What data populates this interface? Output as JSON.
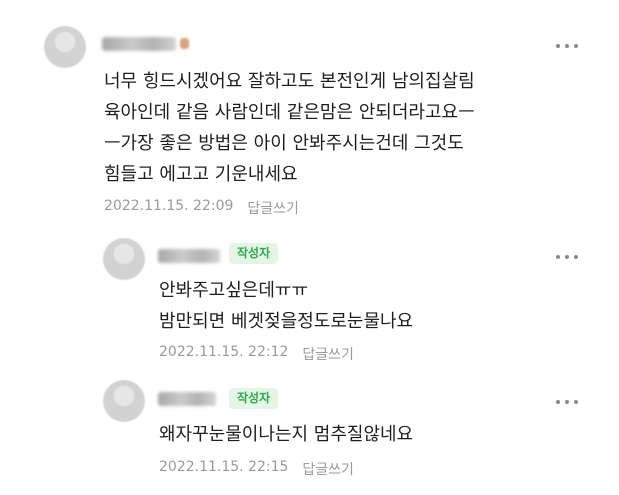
{
  "comments": [
    {
      "author_badge": "",
      "body": "너무 힝드시겠어요 잘하고도 본전인게 남의집살림\n육아인데 같음 사람인데 같은맘은 안되더라고요ㅡ\nㅡ가장 좋은 방법은 아이 안봐주시는건데 그것도\n힘들고 에고고 기운내세요",
      "date": "2022.11.15. 22:09",
      "reply_label": "답글쓰기"
    },
    {
      "author_badge": "작성자",
      "body": "안봐주고싶은데ㅠㅠ\n밤만되면 베겟젖을정도로눈물나요",
      "date": "2022.11.15. 22:12",
      "reply_label": "답글쓰기"
    },
    {
      "author_badge": "작성자",
      "body": "왜자꾸눈물이나는지 멈추질않네요",
      "date": "2022.11.15. 22:15",
      "reply_label": "답글쓰기"
    }
  ],
  "colors": {
    "badge_text": "#2fa84f",
    "badge_bg": "#e4f5e6",
    "meta_text": "#9a9a9a",
    "body_text": "#1f1f1f"
  },
  "icons": {
    "more": "more-vertical-dots-icon",
    "avatar": "default-avatar-icon"
  }
}
